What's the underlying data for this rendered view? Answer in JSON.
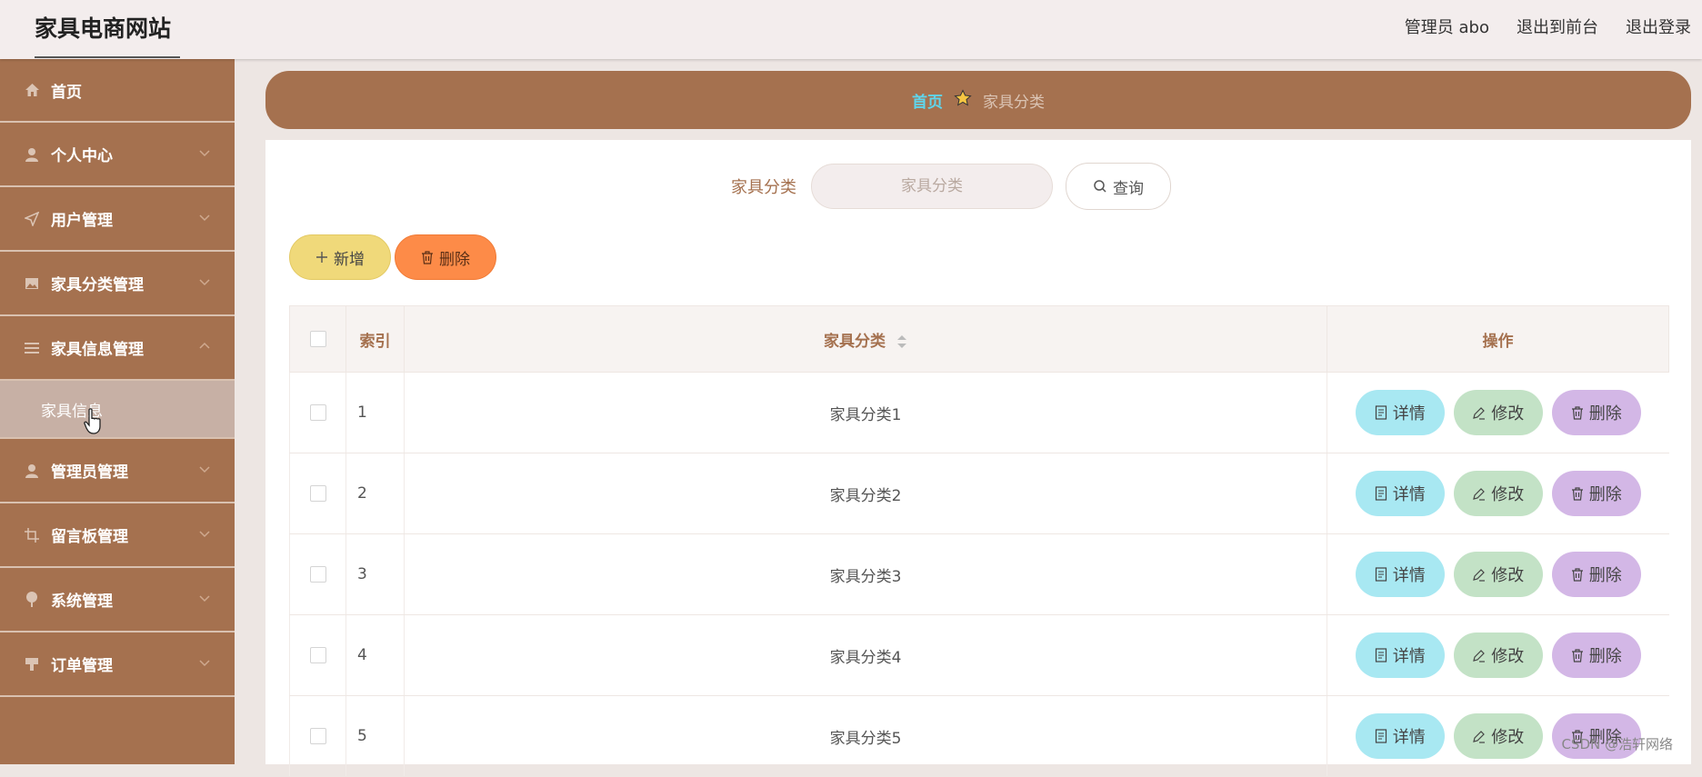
{
  "header": {
    "title": "家具电商网站",
    "links": [
      "管理员 abo",
      "退出到前台",
      "退出登录"
    ]
  },
  "sidebar": {
    "items": [
      {
        "label": "首页",
        "icon": "home-icon"
      },
      {
        "label": "个人中心",
        "icon": "user-icon"
      },
      {
        "label": "用户管理",
        "icon": "send-icon"
      },
      {
        "label": "家具分类管理",
        "icon": "picture-icon"
      },
      {
        "label": "家具信息管理",
        "icon": "menu-icon"
      },
      {
        "label": "管理员管理",
        "icon": "user-icon"
      },
      {
        "label": "留言板管理",
        "icon": "crop-icon"
      },
      {
        "label": "系统管理",
        "icon": "pin-icon"
      },
      {
        "label": "订单管理",
        "icon": "stamp-icon"
      }
    ],
    "submenu": {
      "label": "家具信息"
    }
  },
  "breadcrumb": {
    "home": "首页",
    "current": "家具分类"
  },
  "search": {
    "label": "家具分类",
    "placeholder": "家具分类",
    "button": "查询"
  },
  "toolbar": {
    "add_label": "新增",
    "delete_label": "删除"
  },
  "table": {
    "headers": {
      "index": "索引",
      "name": "家具分类",
      "actions": "操作"
    },
    "rows": [
      {
        "index": "1",
        "name": "家具分类1"
      },
      {
        "index": "2",
        "name": "家具分类2"
      },
      {
        "index": "3",
        "name": "家具分类3"
      },
      {
        "index": "4",
        "name": "家具分类4"
      },
      {
        "index": "5",
        "name": "家具分类5"
      }
    ],
    "row_actions": {
      "detail": "详情",
      "edit": "修改",
      "delete": "删除"
    }
  },
  "watermark": "CSDN @浩轩网络",
  "colors": {
    "sidebar": "#a5714f",
    "accent_home": "#5fd5ec",
    "add": "#f0d97a",
    "delete": "#fd8b48",
    "detail": "#a8e8f2",
    "edit": "#c3e2c6",
    "row_delete": "#d3b7e6"
  }
}
